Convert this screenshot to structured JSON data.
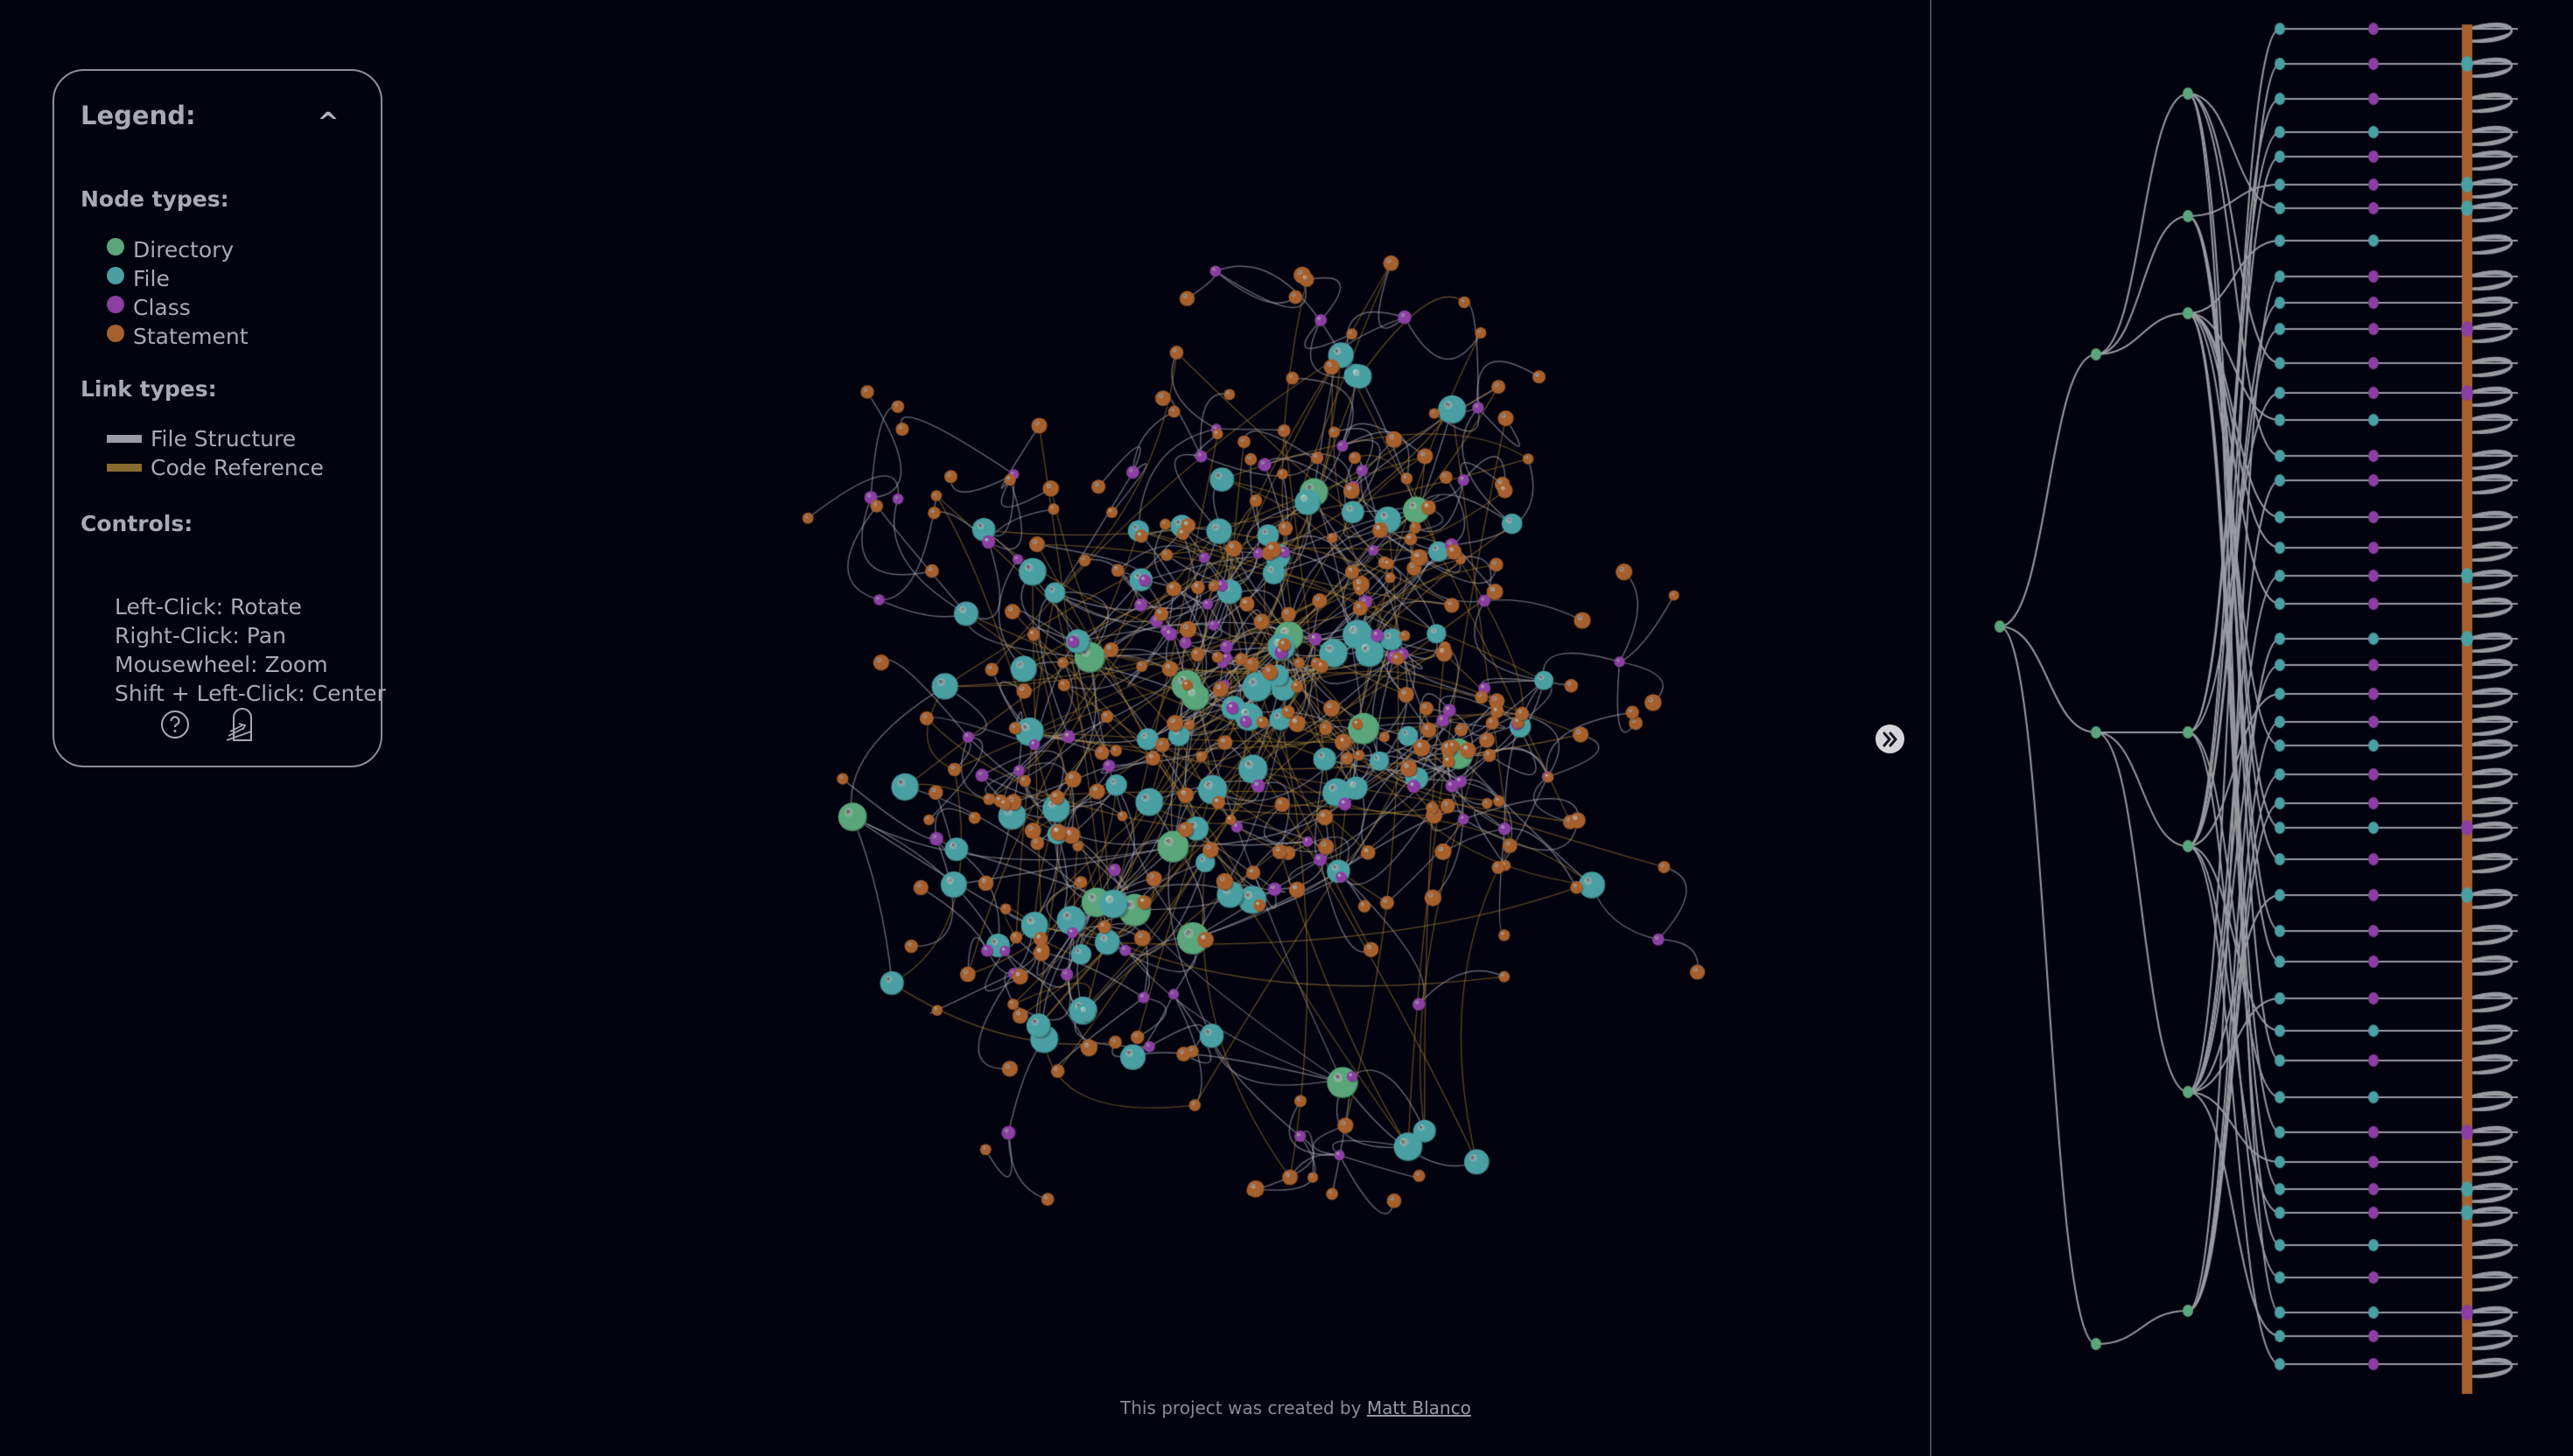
{
  "legend": {
    "title": "Legend:",
    "collapse_icon": "chevron-up-icon",
    "node_types_heading": "Node types:",
    "node_types": [
      {
        "label": "Directory",
        "color": "#5aa67a"
      },
      {
        "label": "File",
        "color": "#4a9fa2"
      },
      {
        "label": "Class",
        "color": "#8b3fa2"
      },
      {
        "label": "Statement",
        "color": "#a5602d"
      }
    ],
    "link_types_heading": "Link types:",
    "link_types": [
      {
        "label": "File Structure",
        "color": "#9b9ba6"
      },
      {
        "label": "Code Reference",
        "color": "#8a6a30"
      }
    ],
    "controls_heading": "Controls:",
    "controls": [
      "Left-Click: Rotate",
      "Right-Click: Pan",
      "Mousewheel: Zoom",
      "Shift + Left-Click: Center"
    ],
    "icons": [
      "help-circle-icon",
      "exit-door-icon"
    ]
  },
  "panel_toggle": {
    "icon": "double-chevron-right-icon"
  },
  "footer": {
    "prefix": "This project was created by ",
    "author": "Matt Blanco"
  },
  "theme": {
    "background": "#03030f",
    "structure_link": "#b4b4bf",
    "reference_link": "#b08a3a"
  }
}
